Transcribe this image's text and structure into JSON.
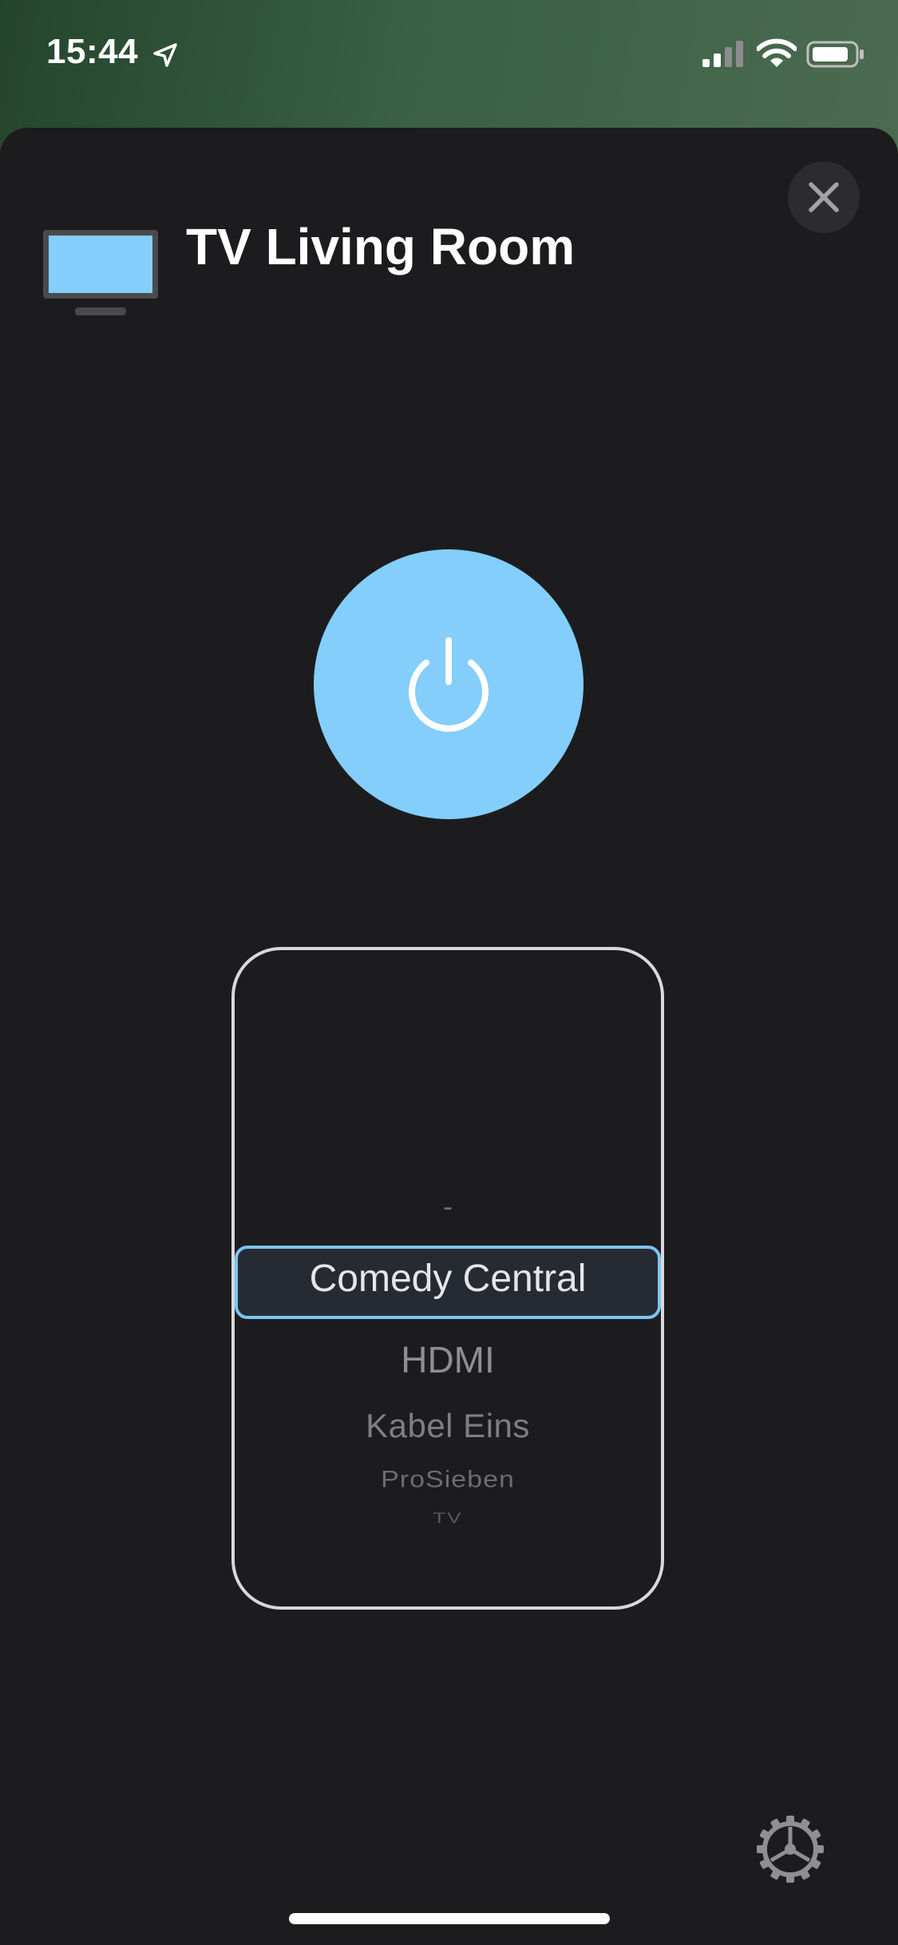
{
  "status_bar": {
    "time": "15:44",
    "location_icon": "location-arrow-icon",
    "signal_icon": "cellular-signal-icon",
    "wifi_icon": "wifi-icon",
    "battery_icon": "battery-icon"
  },
  "header": {
    "device_icon": "tv-icon",
    "title": "TV Living Room",
    "close_icon": "close-icon"
  },
  "power": {
    "icon": "power-icon",
    "color": "#83cefb"
  },
  "input_picker": {
    "items": [
      "-",
      "Comedy Central",
      "HDMI",
      "Kabel Eins",
      "ProSieben",
      "TV"
    ],
    "selected": "Comedy Central",
    "accent_color": "#7cc4f2"
  },
  "footer": {
    "settings_icon": "gear-icon"
  }
}
